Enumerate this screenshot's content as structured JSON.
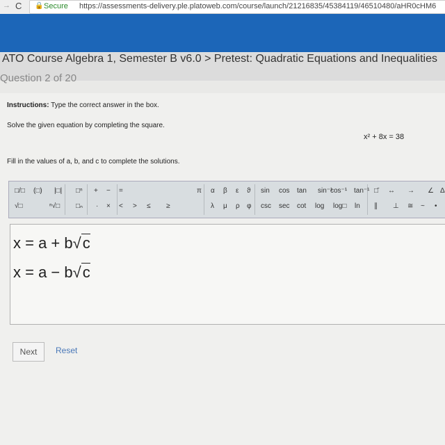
{
  "browser": {
    "secure_label": "Secure",
    "url": "https://assessments-delivery.ple.platoweb.com/course/launch/21216835/45384119/46510480/aHR0cHM6"
  },
  "breadcrumb": "ATO Course Algebra 1, Semester B v6.0 > Pretest: Quadratic Equations and Inequalities",
  "question_counter": "Question 2 of 20",
  "instructions_label": "Instructions:",
  "instructions_text": " Type the correct answer in the box.",
  "prompt": "Solve the given equation by completing the square.",
  "equation": "x² + 8x = 38",
  "fill_prompt": "Fill in the values of a, b, and c to complete the solutions.",
  "toolbar": {
    "row1": [
      "□/□",
      "(□)",
      "|□|",
      "□ⁿ",
      "+",
      "−",
      "=",
      "π",
      "α",
      "β",
      "ε",
      "ϑ",
      "sin",
      "cos",
      "tan",
      "sin⁻¹",
      "cos⁻¹",
      "tan⁻¹",
      "□̄",
      "↔",
      "→",
      "∠",
      "Δ"
    ],
    "row2": [
      "√□",
      "ⁿ√□",
      "□ₙ",
      "·",
      "×",
      "<",
      ">",
      "≤",
      "≥",
      "λ",
      "μ",
      "ρ",
      "φ",
      "csc",
      "sec",
      "cot",
      "log",
      "log□",
      "ln",
      "∥",
      "⊥",
      "≅",
      "~",
      "•"
    ]
  },
  "answers": [
    {
      "lhs": "x = a + b",
      "rad": "c"
    },
    {
      "lhs": "x = a − b",
      "rad": "c"
    }
  ],
  "buttons": {
    "next": "Next",
    "reset": "Reset"
  }
}
